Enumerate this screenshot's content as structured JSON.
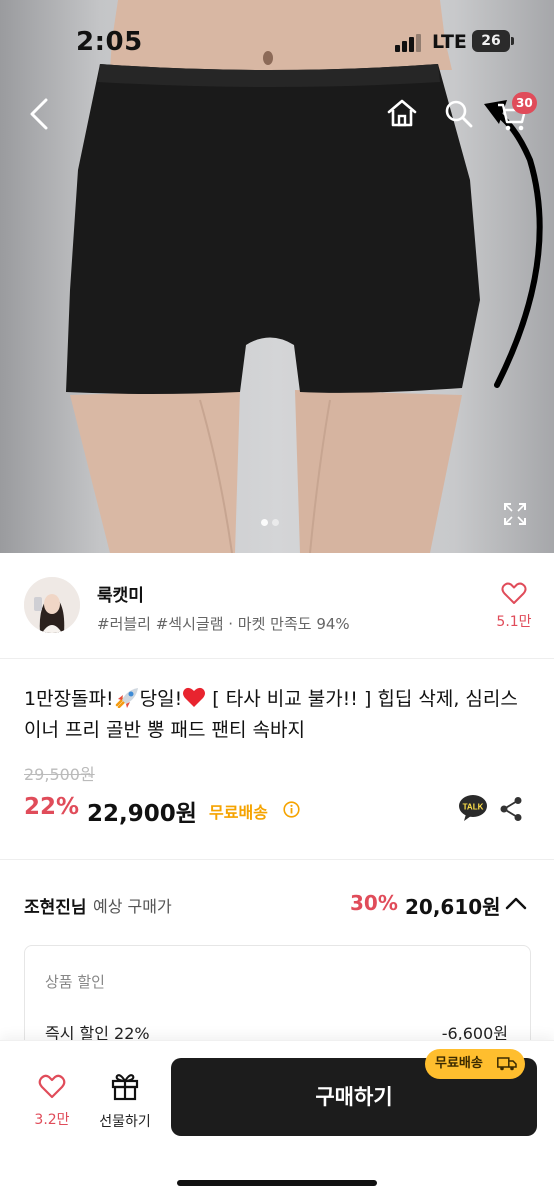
{
  "status_bar": {
    "time": "2:05",
    "network": "LTE",
    "battery": "26"
  },
  "top_nav": {
    "cart_count": "30"
  },
  "seller": {
    "name": "룩캣미",
    "tags": "#러블리 #섹시글램 · 마켓 만족도 94%",
    "like_count": "5.1만"
  },
  "product": {
    "title_part1": "1만장돌파!",
    "title_part2": "당일!",
    "title_part3": " [ 타사 비교 불가!! ] 힙딥 삭제, 심리스 이너 프리 골반 뽕 패드 팬티 속바지",
    "original_price": "29,500원",
    "discount_rate": "22%",
    "sale_price": "22,900원",
    "free_shipping": "무료배송",
    "talk_label": "TALK"
  },
  "expected_price": {
    "buyer_name": "조현진님",
    "label": "예상 구매가",
    "rate": "30%",
    "price": "20,610원"
  },
  "discount_detail": {
    "heading": "상품 할인",
    "instant_label": "즉시 할인 22%",
    "instant_amount": "-6,600원"
  },
  "bottom_bar": {
    "like_count": "3.2만",
    "gift_label": "선물하기",
    "buy_label": "구매하기",
    "ship_badge": "무료배송"
  },
  "colors": {
    "accent_red": "#e04c5a",
    "shipping_yellow": "#f5a300",
    "buy_button": "#1c1c1c"
  }
}
